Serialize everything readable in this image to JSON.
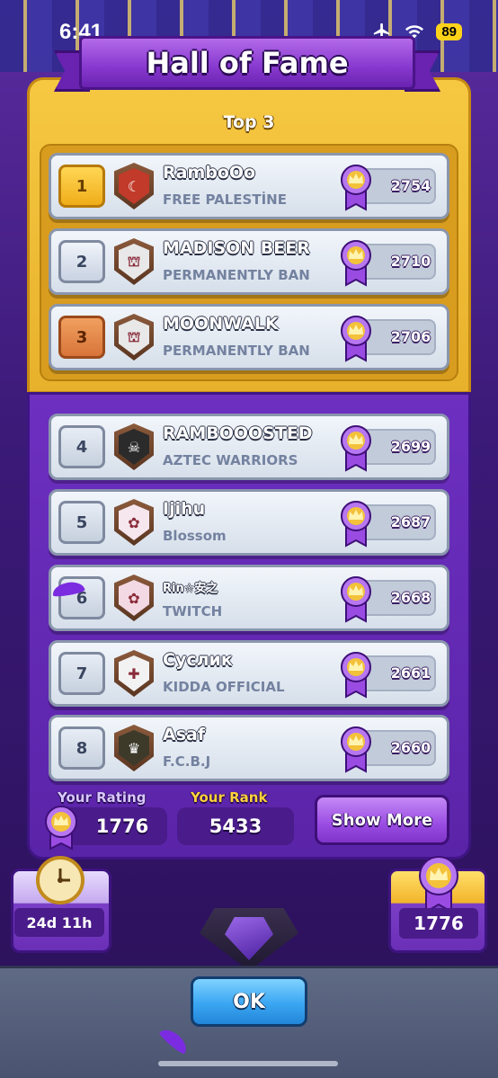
{
  "status_bar": {
    "time": "6:41",
    "battery": "89"
  },
  "title": "Hall of Fame",
  "top3_label": "Top 3",
  "players": [
    {
      "rank": "1",
      "name": "RamboOo",
      "clan": "FREE PALESTİNE",
      "trophies": "2754",
      "badge_color": "#c23a2a",
      "badge_symbol": "☾"
    },
    {
      "rank": "2",
      "name": "MADISON BEER",
      "clan": "PERMANENTLY BAN",
      "trophies": "2710",
      "badge_color": "#e8e8e8",
      "badge_symbol": "⛫"
    },
    {
      "rank": "3",
      "name": "MOONWALK",
      "clan": "PERMANENTLY BAN",
      "trophies": "2706",
      "badge_color": "#e8e8e8",
      "badge_symbol": "⛫"
    },
    {
      "rank": "4",
      "name": "RAMBOOOSTED",
      "clan": "AZTEC WARRIORS",
      "trophies": "2699",
      "badge_color": "#2b2b2b",
      "badge_symbol": "☠"
    },
    {
      "rank": "5",
      "name": "Ijihu",
      "clan": "Blossom",
      "trophies": "2687",
      "badge_color": "#f6e6ee",
      "badge_symbol": "✿"
    },
    {
      "rank": "6",
      "name": "Rin☆安之",
      "clan": "TWITCH",
      "trophies": "2668",
      "badge_color": "#f3d9e3",
      "badge_symbol": "✿"
    },
    {
      "rank": "7",
      "name": "Суслик",
      "clan": "KIDDA OFFICIAL",
      "trophies": "2661",
      "badge_color": "#f2f2f2",
      "badge_symbol": "✚"
    },
    {
      "rank": "8",
      "name": "Asaf",
      "clan": "F.C.B.J",
      "trophies": "2660",
      "badge_color": "#3d3a2a",
      "badge_symbol": "♛"
    }
  ],
  "your_rating": {
    "label": "Your Rating",
    "value": "1776"
  },
  "your_rank": {
    "label": "Your Rank",
    "value": "5433"
  },
  "show_more_label": "Show More",
  "timer": "24d 11h",
  "trophy_road": "1776",
  "ok_label": "OK",
  "colors": {
    "gold": "#f2bf3a",
    "purple": "#6d2fc0",
    "rating_label": "#d9c8ff",
    "rank_label": "#ffd23a",
    "ok_blue": "#3aa6f2"
  }
}
